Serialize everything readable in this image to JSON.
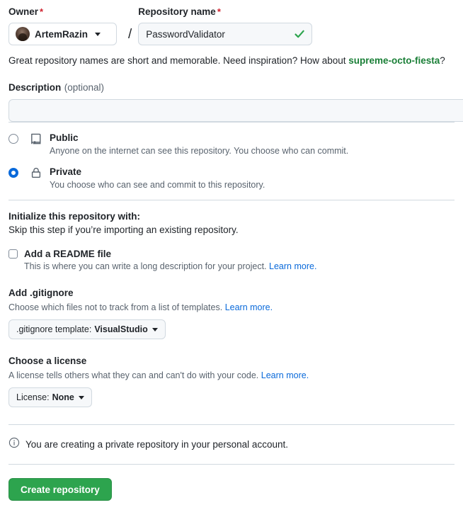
{
  "owner": {
    "label": "Owner",
    "required_mark": "*",
    "name": "ArtemRazin",
    "avatar_alt": "user-avatar"
  },
  "separator": "/",
  "repo_name": {
    "label": "Repository name",
    "required_mark": "*",
    "value": "PasswordValidator",
    "valid": true
  },
  "hint": {
    "prefix": "Great repository names are short and memorable. Need inspiration? How about ",
    "suggestion": "supreme-octo-fiesta",
    "suffix": "?"
  },
  "description": {
    "label": "Description",
    "optional_note": "(optional)",
    "value": "",
    "placeholder": ""
  },
  "visibility": {
    "options": [
      {
        "id": "public",
        "title": "Public",
        "description": "Anyone on the internet can see this repository. You choose who can commit.",
        "selected": false,
        "icon": "repo-icon"
      },
      {
        "id": "private",
        "title": "Private",
        "description": "You choose who can see and commit to this repository.",
        "selected": true,
        "icon": "lock-icon"
      }
    ]
  },
  "initialize": {
    "title": "Initialize this repository with:",
    "subtitle": "Skip this step if you’re importing an existing repository.",
    "readme": {
      "label": "Add a README file",
      "checked": false,
      "help": "This is where you can write a long description for your project.",
      "link": "Learn more."
    }
  },
  "gitignore": {
    "title": "Add .gitignore",
    "help": "Choose which files not to track from a list of templates.",
    "link": "Learn more.",
    "button_prefix": ".gitignore template:",
    "button_value": "VisualStudio"
  },
  "license": {
    "title": "Choose a license",
    "help": "A license tells others what they can and can't do with your code.",
    "link": "Learn more.",
    "button_prefix": "License:",
    "button_value": "None"
  },
  "notice": {
    "icon": "info-icon",
    "text": "You are creating a private repository in your personal account."
  },
  "submit": {
    "label": "Create repository"
  },
  "colors": {
    "accent_green": "#2da44e",
    "link_blue": "#0969da",
    "required_red": "#cf222e",
    "suggestion_green": "#1a7f37",
    "radio_blue": "#0969da",
    "border": "#d1d9e0",
    "field_bg": "#f6f8fa",
    "muted_text": "#59636e"
  }
}
